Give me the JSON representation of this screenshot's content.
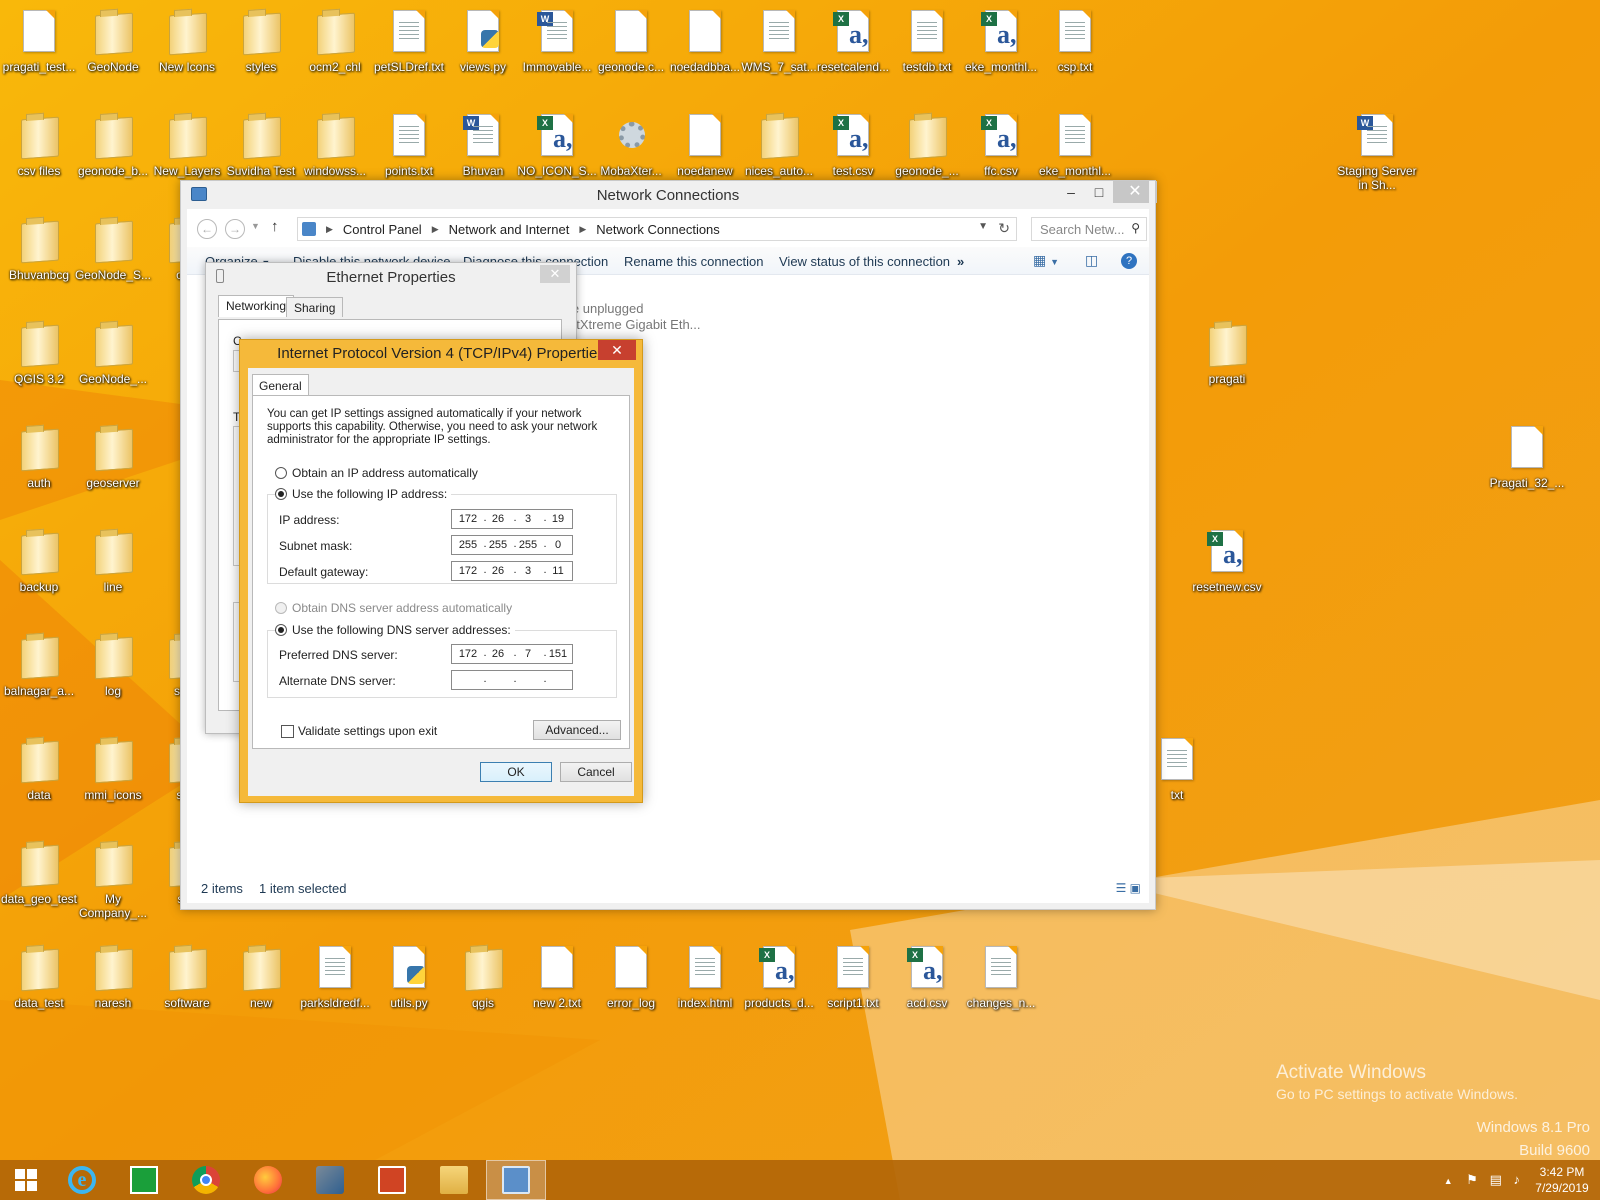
{
  "desktop": {
    "icons": [
      {
        "label": "pragati_test...",
        "type": "file",
        "x": 0,
        "y": 0
      },
      {
        "label": "GeoNode",
        "type": "folder"
      },
      {
        "label": "New Icons",
        "type": "folder"
      },
      {
        "label": "styles",
        "type": "folder"
      },
      {
        "label": "ocm2_chl",
        "type": "folder"
      },
      {
        "label": "petSLDref.txt",
        "type": "text"
      },
      {
        "label": "views.py",
        "type": "python"
      },
      {
        "label": "Immovable...",
        "type": "word"
      },
      {
        "label": "geonode.c...",
        "type": "file"
      },
      {
        "label": "noedadbba...",
        "type": "file"
      },
      {
        "label": "WMS_7_sat...",
        "type": "text"
      },
      {
        "label": "resetcalend...",
        "type": "excel"
      },
      {
        "label": "testdb.txt",
        "type": "text"
      },
      {
        "label": "eke_monthl...",
        "type": "excel"
      },
      {
        "label": "csp.txt",
        "type": "text"
      },
      {
        "label": "csv files",
        "type": "folder"
      },
      {
        "label": "geonode_b...",
        "type": "folder"
      },
      {
        "label": "New_Layers",
        "type": "folder"
      },
      {
        "label": "Suvidha Test",
        "type": "folder"
      },
      {
        "label": "windowss...",
        "type": "folder"
      },
      {
        "label": "points.txt",
        "type": "text"
      },
      {
        "label": "Bhuvan",
        "type": "word"
      },
      {
        "label": "NO_ICON_S...",
        "type": "excel"
      },
      {
        "label": "MobaXter...",
        "type": "gear"
      },
      {
        "label": "noedanew",
        "type": "file"
      },
      {
        "label": "nices_auto...",
        "type": "folder"
      },
      {
        "label": "test.csv",
        "type": "excel"
      },
      {
        "label": "geonode_...",
        "type": "folder"
      },
      {
        "label": "ffc.csv",
        "type": "excel"
      },
      {
        "label": "eke_monthl...",
        "type": "text"
      },
      {
        "label": "Staging Server in Sh...",
        "type": "word"
      },
      {
        "label": "Bhuvanbcg",
        "type": "folder"
      },
      {
        "label": "GeoNode_S...",
        "type": "folder"
      },
      {
        "label": "offic",
        "type": "folder"
      },
      {
        "label": "QGIS 3.2",
        "type": "folder"
      },
      {
        "label": "GeoNode_...",
        "type": "folder"
      },
      {
        "label": "pragati",
        "type": "folder"
      },
      {
        "label": "auth",
        "type": "folder"
      },
      {
        "label": "geoserver",
        "type": "folder"
      },
      {
        "label": "Pragati_32_...",
        "type": "file"
      },
      {
        "label": "backup",
        "type": "folder"
      },
      {
        "label": "line",
        "type": "folder"
      },
      {
        "label": "resetnew.csv",
        "type": "excel"
      },
      {
        "label": "balnagar_a...",
        "type": "folder"
      },
      {
        "label": "log",
        "type": "folder"
      },
      {
        "label": "shad",
        "type": "folder"
      },
      {
        "label": "data",
        "type": "folder"
      },
      {
        "label": "mmi_icons",
        "type": "folder"
      },
      {
        "label": "shfil",
        "type": "folder"
      },
      {
        "label": "txt",
        "type": "text"
      },
      {
        "label": "data_geo_test",
        "type": "folder"
      },
      {
        "label": "My Company_...",
        "type": "folder"
      },
      {
        "label": "shp",
        "type": "folder"
      },
      {
        "label": "data_test",
        "type": "folder"
      },
      {
        "label": "naresh",
        "type": "folder"
      },
      {
        "label": "software",
        "type": "folder"
      },
      {
        "label": "new",
        "type": "folder"
      },
      {
        "label": "parksldredf...",
        "type": "text"
      },
      {
        "label": "utils.py",
        "type": "python"
      },
      {
        "label": "qgis",
        "type": "folder"
      },
      {
        "label": "new 2.txt",
        "type": "file"
      },
      {
        "label": "error_log",
        "type": "file"
      },
      {
        "label": "index.html",
        "type": "text"
      },
      {
        "label": "products_d...",
        "type": "excel"
      },
      {
        "label": "script1.txt",
        "type": "text"
      },
      {
        "label": "acd.csv",
        "type": "excel"
      },
      {
        "label": "changes_n...",
        "type": "text"
      }
    ]
  },
  "explorer": {
    "title": "Network Connections",
    "breadcrumb": [
      "Control Panel",
      "Network and Internet",
      "Network Connections"
    ],
    "search_placeholder": "Search Netw...",
    "commands": [
      "Organize",
      "Disable this network device",
      "Diagnose this connection",
      "Rename this connection",
      "View status of this connection"
    ],
    "more": "»",
    "item_line1": "le unplugged",
    "item_line2": "etXtreme Gigabit Eth...",
    "status_items": "2 items",
    "status_selected": "1 item selected"
  },
  "ethernet": {
    "title": "Ethernet Properties",
    "tabs": [
      "Networking",
      "Sharing"
    ],
    "ghost_label": "C",
    "ghost_t": "T"
  },
  "ipv4": {
    "title": "Internet Protocol Version 4 (TCP/IPv4) Properties",
    "tab": "General",
    "intro": "You can get IP settings assigned automatically if your network supports this capability. Otherwise, you need to ask your network administrator for the appropriate IP settings.",
    "radio_auto_ip": "Obtain an IP address automatically",
    "radio_manual_ip": "Use the following IP address:",
    "ip_label": "IP address:",
    "ip": [
      "172",
      "26",
      "3",
      "19"
    ],
    "mask_label": "Subnet mask:",
    "mask": [
      "255",
      "255",
      "255",
      "0"
    ],
    "gw_label": "Default gateway:",
    "gw": [
      "172",
      "26",
      "3",
      "11"
    ],
    "radio_auto_dns": "Obtain DNS server address automatically",
    "radio_manual_dns": "Use the following DNS server addresses:",
    "pdns_label": "Preferred DNS server:",
    "pdns": [
      "172",
      "26",
      "7",
      "151"
    ],
    "adns_label": "Alternate DNS server:",
    "adns": [
      "",
      "",
      "",
      ""
    ],
    "validate_label": "Validate settings upon exit",
    "advanced_label": "Advanced...",
    "ok_label": "OK",
    "cancel_label": "Cancel"
  },
  "watermark": {
    "line1": "Activate Windows",
    "line2": "Go to PC settings to activate Windows.",
    "edition": "Windows 8.1 Pro",
    "build": "Build 9600"
  },
  "taskbar": {
    "time": "3:42 PM",
    "date": "7/29/2019",
    "tray_arrow": "▲"
  },
  "colors": {
    "accent_dialog": "#f5b93a",
    "taskbar": "#b26608",
    "close_red": "#c7402f"
  }
}
